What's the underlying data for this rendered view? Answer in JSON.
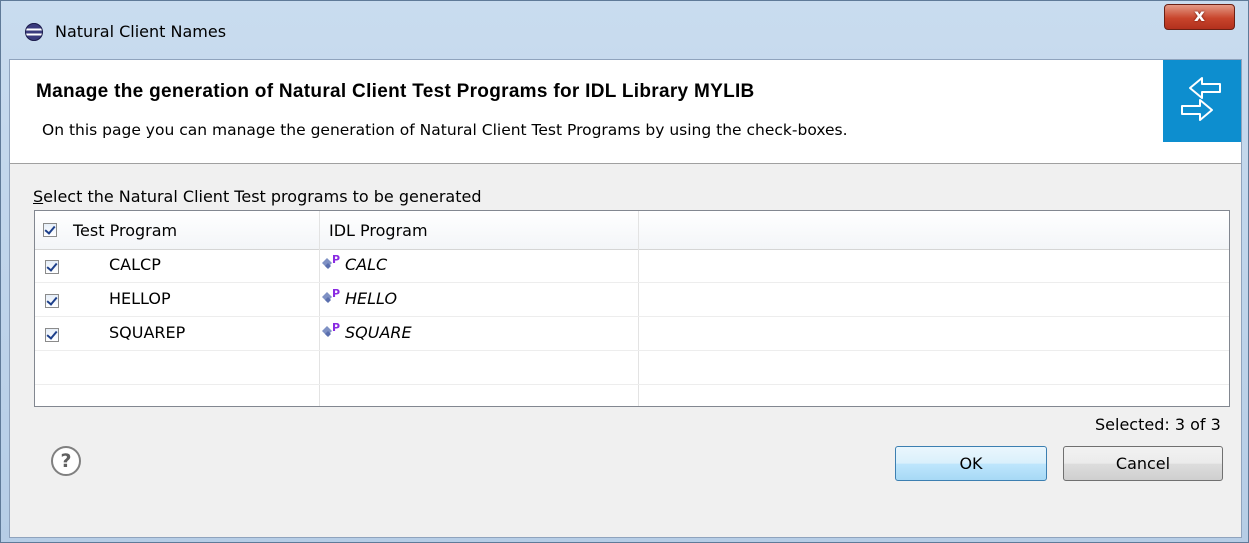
{
  "window": {
    "title": "Natural Client Names",
    "close_label": "x"
  },
  "header": {
    "title": "Manage the generation of Natural Client Test Programs for IDL Library MYLIB",
    "description": "On this page you can manage the generation of Natural Client Test Programs by using the check-boxes."
  },
  "selection": {
    "label_mnemonic": "S",
    "label_rest": "elect the Natural Client Test programs to be generated",
    "count_text": "Selected: 3 of 3"
  },
  "table": {
    "columns": [
      "Test Program",
      "IDL Program"
    ],
    "header_checked": true,
    "rows": [
      {
        "checked": true,
        "test_program": "CALCP",
        "idl_program": "CALC",
        "idl_icon": "idl-program-icon"
      },
      {
        "checked": true,
        "test_program": "HELLOP",
        "idl_program": "HELLO",
        "idl_icon": "idl-program-icon"
      },
      {
        "checked": true,
        "test_program": "SQUAREP",
        "idl_program": "SQUARE",
        "idl_icon": "idl-program-icon"
      }
    ]
  },
  "buttons": {
    "help": "?",
    "ok": "OK",
    "cancel": "Cancel"
  },
  "colors": {
    "banner": "#0d8ecf",
    "close_button": "#c8452c",
    "icon_purple": "#8a2be2"
  }
}
